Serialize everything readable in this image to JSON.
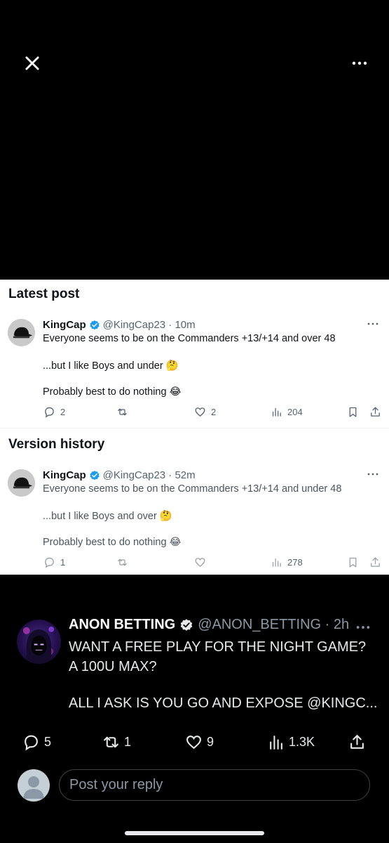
{
  "viewer": {
    "close_icon": "close-icon",
    "more_icon": "more-horizontal-icon"
  },
  "latest": {
    "section_title": "Latest post",
    "author_name": "KingCap",
    "handle_time": "@KingCap23 · 10m",
    "line1": "Everyone seems to be on the Commanders +13/+14 and over 48",
    "line2": "...but I like Boys and under 🤔",
    "line3": "Probably best to do nothing 😂",
    "replies": "2",
    "retweets": "",
    "likes": "2",
    "views": "204"
  },
  "history": {
    "section_title": "Version history",
    "author_name": "KingCap",
    "handle_time": "@KingCap23 · 52m",
    "line1": "Everyone seems to be on the Commanders +13/+14 and under 48",
    "line2": "...but I like Boys and over 🤔",
    "line3": "Probably best to do nothing 😂",
    "replies": "1",
    "retweets": "",
    "likes": "",
    "views": "278"
  },
  "reply_tweet": {
    "author_name": "ANON BETTING",
    "handle_time": "@ANON_BETTING · 2h",
    "line1": "WANT A FREE PLAY FOR THE NIGHT GAME?",
    "line2": "A 100U MAX?",
    "line3": "ALL I ASK IS YOU GO AND EXPOSE @KINGC...",
    "replies": "5",
    "retweets": "1",
    "likes": "9",
    "views": "1.3K"
  },
  "compose": {
    "placeholder": "Post your reply"
  },
  "colors": {
    "verified_blue": "#1d9bf0",
    "background": "#000000",
    "card_background": "#ffffff"
  }
}
